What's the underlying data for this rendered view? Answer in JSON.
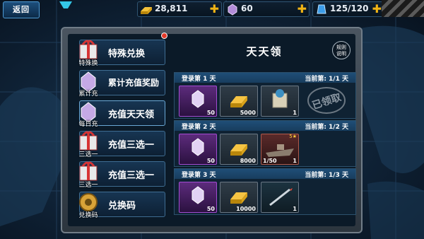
{
  "topbar": {
    "back_label": "返回",
    "gold": "28,811",
    "gems": "60",
    "energy": "125/120"
  },
  "menu": [
    {
      "label": "特殊兑换",
      "icon_caption": "特殊换",
      "icon": "gift-box-icon"
    },
    {
      "label": "累计充值奖励",
      "icon_caption": "累计充",
      "icon": "purple-gem-icon"
    },
    {
      "label": "充值天天领",
      "icon_caption": "每日充",
      "icon": "purple-gem-icon"
    },
    {
      "label": "充值三选一",
      "icon_caption": "三选一",
      "icon": "gift-box-icon"
    },
    {
      "label": "充值三选一",
      "icon_caption": "三选一",
      "icon": "gift-box-icon"
    },
    {
      "label": "兑换码",
      "icon_caption": "兑换码",
      "icon": "gear-medal-icon"
    }
  ],
  "content": {
    "title": "天天领",
    "rules_line1": "规则",
    "rules_line2": "说明",
    "days": [
      {
        "label": "登录第 1 天",
        "progress": "当前第: 1/1 天",
        "rewards": [
          {
            "qty": "50"
          },
          {
            "qty": "5000"
          },
          {
            "qty": "1"
          }
        ],
        "claimed_stamp": "已领取"
      },
      {
        "label": "登录第 2 天",
        "progress": "当前第: 1/2 天",
        "rewards": [
          {
            "qty": "50"
          },
          {
            "qty": "8000"
          },
          {
            "qty": "1",
            "progress": "1/50",
            "stars": "5★"
          }
        ]
      },
      {
        "label": "登录第 3 天",
        "progress": "当前第: 1/3 天",
        "rewards": [
          {
            "qty": "50"
          },
          {
            "qty": "10000"
          },
          {
            "qty": "1"
          }
        ]
      }
    ]
  },
  "colors": {
    "accent": "#f0b415",
    "purple": "#a24bd1",
    "header_blue": "#1f4e77"
  }
}
